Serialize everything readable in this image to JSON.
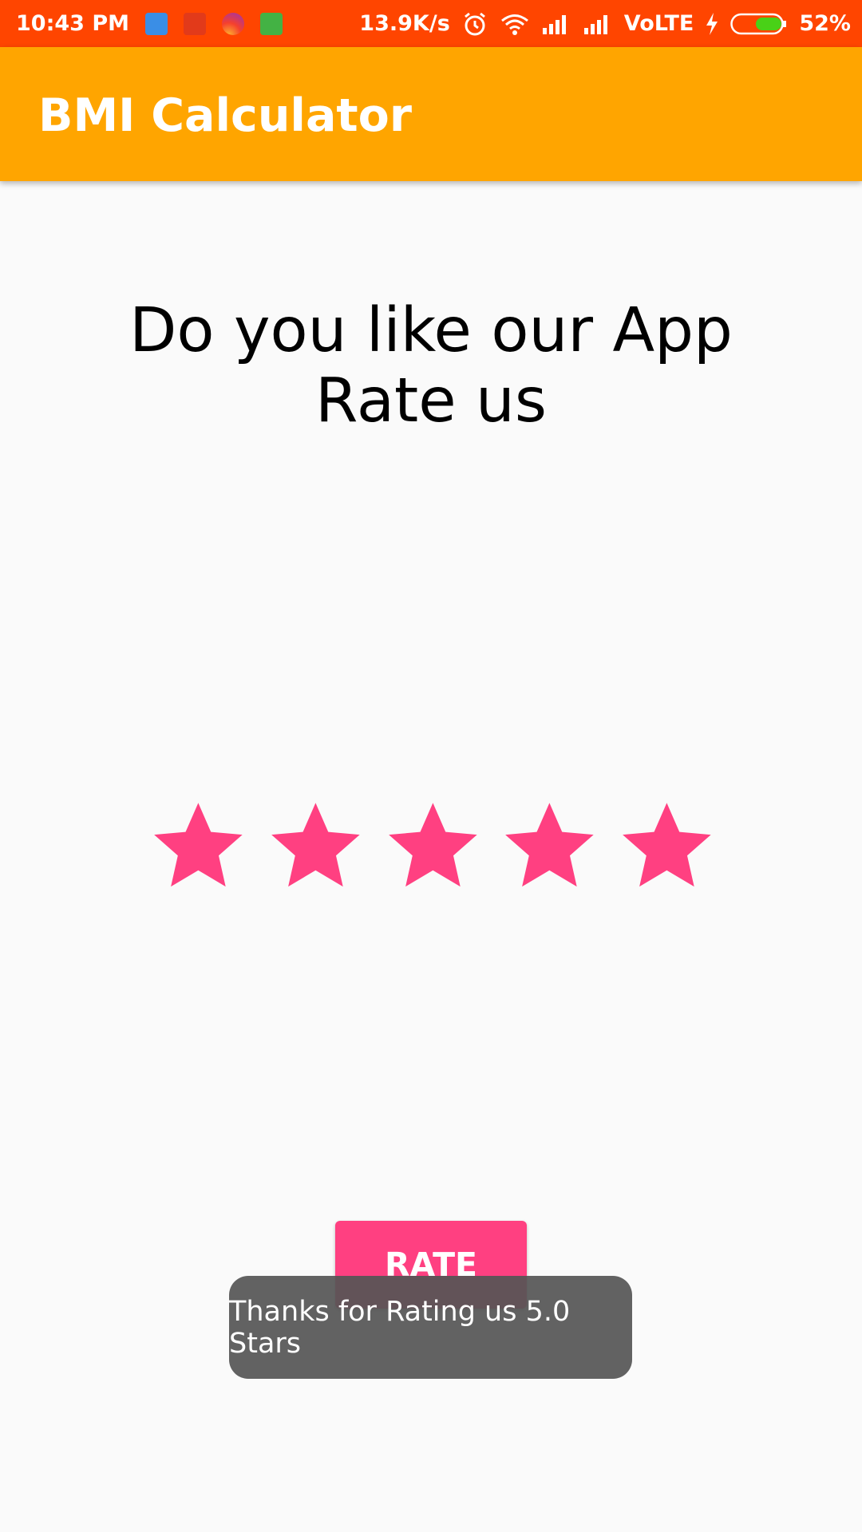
{
  "status_bar": {
    "time": "10:43 PM",
    "net_speed": "13.9K/s",
    "network_type": "VoLTE",
    "battery": "52%",
    "battery_level": 0.52,
    "notification_icons": [
      "usb-icon",
      "shopping-bag-icon",
      "instagram-icon",
      "android-icon"
    ],
    "status_icons": [
      "alarm-icon",
      "wifi-icon",
      "signal-icon",
      "signal-icon",
      "charging-bolt-icon",
      "battery-icon"
    ]
  },
  "app_bar": {
    "title": "BMI Calculator"
  },
  "main": {
    "prompt_line1": "Do you like our App",
    "prompt_line2": "Rate us",
    "rating": {
      "value": 5,
      "max": 5,
      "star_color": "#ff4081"
    },
    "rate_button": "RATE"
  },
  "toast": {
    "message": "Thanks for Rating us 5.0 Stars"
  },
  "colors": {
    "status_bar": "#ff4500",
    "app_bar": "#ffa500",
    "accent": "#ff4081",
    "background": "#fafafa"
  }
}
